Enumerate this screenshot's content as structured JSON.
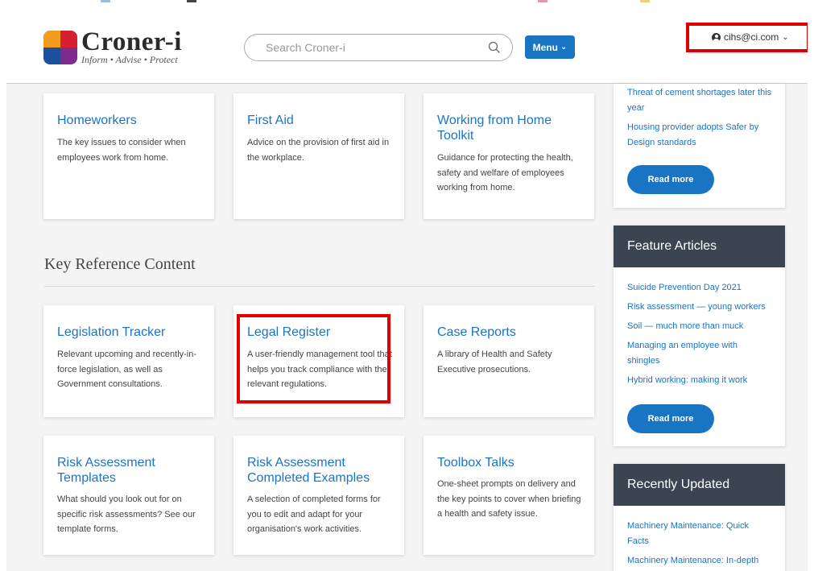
{
  "brand": {
    "name": "Croner-i",
    "tagline": "Inform • Advise • Protect",
    "colors": [
      "#f29b1d",
      "#d6202f",
      "#7b2c8c",
      "#1c4f9c"
    ]
  },
  "header": {
    "search_placeholder": "Search Croner-i",
    "menu_label": "Menu",
    "user_email": "cihs@ci.com",
    "accent_color": "#1a74c4",
    "highlight_color": "#e00000"
  },
  "top_cards": [
    {
      "title": "Homeworkers",
      "description": "The key issues to consider when employees work from home."
    },
    {
      "title": "First Aid",
      "description": "Advice on the provision of first aid in the workplace."
    },
    {
      "title": "Working from Home Toolkit",
      "description": "Guidance for protecting the health, safety and welfare of employees working from home."
    }
  ],
  "key_reference": {
    "heading": "Key Reference Content",
    "cards": [
      {
        "title": "Legislation Tracker",
        "description": "Relevant upcoming and recently-in-force legislation, as well as Government consultations."
      },
      {
        "title": "Legal Register",
        "description": "A user-friendly management tool that helps you track compliance with the relevant regulations."
      },
      {
        "title": "Case Reports",
        "description": "A library of Health and Safety Executive prosecutions."
      },
      {
        "title": "Risk Assessment Templates",
        "description": "What should you look out for on specific risk assessments? See our template forms."
      },
      {
        "title": "Risk Assessment Completed Examples",
        "description": "A selection of completed forms for you to edit and adapt for your organisation's work activities."
      },
      {
        "title": "Toolbox Talks",
        "description": "One-sheet prompts on delivery and the key points to cover when briefing a health and safety issue."
      }
    ]
  },
  "sidebar": {
    "news": {
      "links": [
        "Threat of cement shortages later this year",
        "Housing provider adopts Safer by Design standards"
      ],
      "button": "Read more"
    },
    "feature_articles": {
      "title": "Feature Articles",
      "links": [
        "Suicide Prevention Day 2021",
        "Risk assessment — young workers",
        "Soil — much more than muck",
        "Managing an employee with shingles",
        "Hybrid working: making it work"
      ],
      "button": "Read more"
    },
    "recently_updated": {
      "title": "Recently Updated",
      "links": [
        "Machinery Maintenance: Quick Facts",
        "Machinery Maintenance: In-depth"
      ]
    }
  }
}
